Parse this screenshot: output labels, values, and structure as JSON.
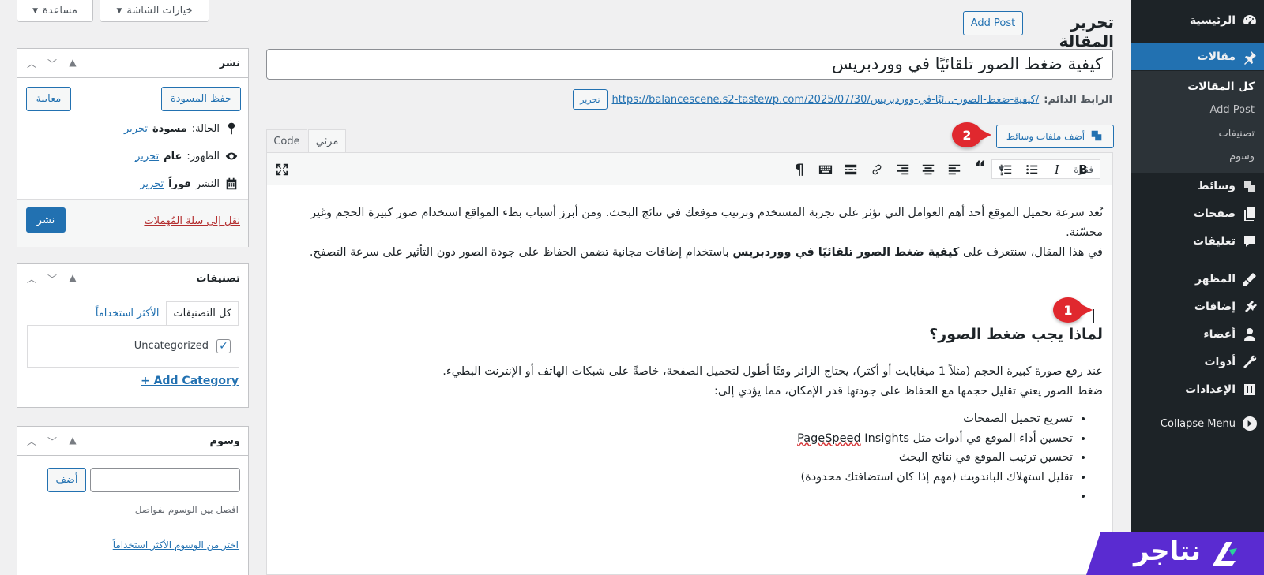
{
  "sidebar": {
    "items": [
      {
        "label": "الرئيسية",
        "icon": "dashboard-icon"
      },
      {
        "label": "مقالات",
        "icon": "pin-icon"
      },
      {
        "label": "وسائط",
        "icon": "media-icon"
      },
      {
        "label": "صفحات",
        "icon": "pages-icon"
      },
      {
        "label": "تعليقات",
        "icon": "comments-icon"
      },
      {
        "label": "المظهر",
        "icon": "appearance-icon"
      },
      {
        "label": "إضافات",
        "icon": "plugins-icon"
      },
      {
        "label": "أعضاء",
        "icon": "users-icon"
      },
      {
        "label": "أدوات",
        "icon": "tools-icon"
      },
      {
        "label": "الإعدادات",
        "icon": "settings-icon"
      }
    ],
    "submenu": [
      "كل المقالات",
      "Add Post",
      "تصنيفات",
      "وسوم"
    ],
    "collapse": "Collapse Menu"
  },
  "top": {
    "screen_options": "خيارات الشاشة",
    "help": "مساعدة"
  },
  "header": {
    "title": "تحرير المقالة",
    "add_post": "Add Post"
  },
  "post": {
    "title": "كيفية ضغط الصور تلقائيًا في ووردبريس",
    "permalink_label": "الرابط الدائم:",
    "permalink_base": "https://balancescene.s2-tastewp.com/2025/07/30/",
    "permalink_slug": "كيفية-ضغط-الصور-...ئيًا-في-ووردبريس/",
    "permalink_edit": "تحرير"
  },
  "editor": {
    "add_media": "أضف ملفات وسائط",
    "tab_visual": "مرئي",
    "tab_code": "Code",
    "format": "فقرة",
    "p1": "تُعد سرعة تحميل الموقع أحد أهم العوامل التي تؤثر على تجربة المستخدم وترتيب موقعك في نتائج البحث. ومن أبرز أسباب بطء المواقع استخدام صور كبيرة الحجم وغير محسّنة.",
    "p2_before": "في هذا المقال، سنتعرف على ",
    "p2_bold": "كيفية ضغط الصور تلقائيًا في ووردبريس",
    "p2_after": " باستخدام إضافات مجانية تضمن الحفاظ على جودة الصور دون التأثير على سرعة التصفح.",
    "h2": "لماذا يجب ضغط الصور؟",
    "p3": "عند رفع صورة كبيرة الحجم (مثلاً 1 ميغابايت أو أكثر)، يحتاج الزائر وقتًا أطول لتحميل الصفحة، خاصةً على شبكات الهاتف أو الإنترنت البطيء.",
    "p4": "ضغط الصور يعني تقليل حجمها مع الحفاظ على جودتها قدر الإمكان، مما يؤدي إلى:",
    "li1": "تسريع تحميل الصفحات",
    "li2_before": "تحسين أداء الموقع في أدوات مثل ",
    "li2_spell": "PageSpeed",
    "li2_after": " Insights",
    "li3": "تحسين ترتيب الموقع في نتائج البحث",
    "li4": "تقليل استهلاك الباندويث (مهم إذا كان استضافتك محدودة)"
  },
  "badges": {
    "one": "1",
    "two": "2"
  },
  "publish": {
    "title": "نشر",
    "save_draft": "حفظ المسودة",
    "preview": "معاينة",
    "status_label": "الحالة:",
    "status_value": "مسودة",
    "visibility_label": "الظهور:",
    "visibility_value": "عام",
    "schedule_label": "النشر",
    "schedule_value": "فوراً",
    "edit": "تحرير",
    "trash": "نقل إلى سلة المُهملات",
    "publish": "نشر"
  },
  "categories": {
    "title": "تصنيفات",
    "tab_all": "كل التصنيفات",
    "tab_most": "الأكثر استخداماً",
    "item": "Uncategorized",
    "add": "+ Add Category"
  },
  "tags": {
    "title": "وسوم",
    "add": "أضف",
    "hint": "افصل بين الوسوم بفواصل",
    "most_used": "اختر من الوسوم الأكثر استخداماً"
  },
  "brand": {
    "name": "نتاجر",
    "color": "#5a2bd1"
  }
}
